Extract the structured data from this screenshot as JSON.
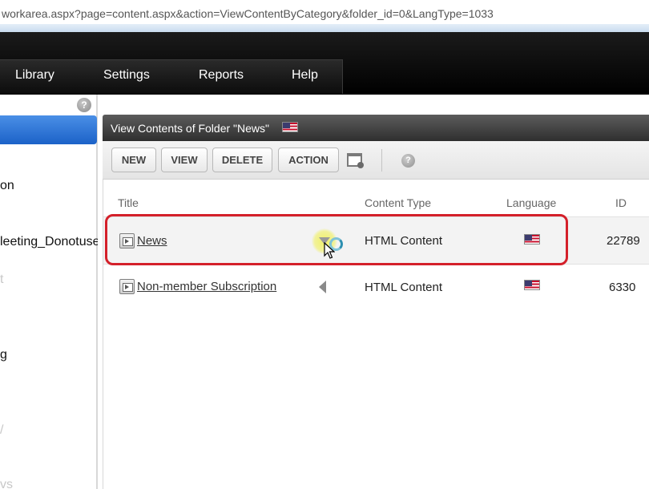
{
  "browser": {
    "url": "workarea.aspx?page=content.aspx&action=ViewContentByCategory&folder_id=0&LangType=1033"
  },
  "menu": {
    "items": [
      {
        "label": "Library"
      },
      {
        "label": "Settings"
      },
      {
        "label": "Reports"
      },
      {
        "label": "Help"
      }
    ]
  },
  "sidebar": {
    "help_glyph": "?",
    "items": [
      {
        "label": "on"
      },
      {
        "label": "leeting_Donotuse"
      },
      {
        "label": "t"
      },
      {
        "label": "g"
      },
      {
        "label": "/"
      },
      {
        "label": "vs"
      }
    ]
  },
  "panel": {
    "title": "View Contents of Folder \"News\"",
    "flag_icon": "us-flag-icon"
  },
  "toolbar": {
    "new_label": "NEW",
    "view_label": "VIEW",
    "delete_label": "DELETE",
    "action_label": "ACTION",
    "help_glyph": "?"
  },
  "table": {
    "columns": [
      "Title",
      "Content Type",
      "Language",
      "ID"
    ],
    "rows": [
      {
        "title": "News",
        "content_type": "HTML Content",
        "language": "us-flag-icon",
        "id": "22789"
      },
      {
        "title": "Non-member Subscription",
        "content_type": "HTML Content",
        "language": "us-flag-icon",
        "id": "6330"
      }
    ]
  },
  "colors": {
    "highlight": "#d4202a",
    "sidebar_accent": "#1c62c8",
    "nav_background": "#000000"
  }
}
